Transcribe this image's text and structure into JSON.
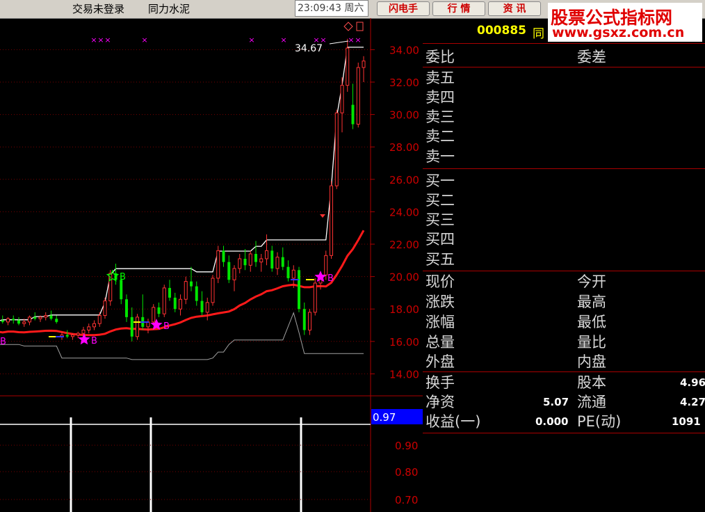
{
  "toolbar": {
    "login_status": "交易未登录",
    "stock_name": "同力水泥",
    "clock": "23:09:43 周六",
    "buttons": [
      "闪电手",
      "行 情",
      "资 讯"
    ]
  },
  "watermark": {
    "line1": "股票公式指标网",
    "line2": "www.gsxz.com.cn"
  },
  "colors": {
    "up": "#ff3232",
    "down": "#00e600",
    "grid": "#7a0000",
    "axis_text": "#cc0000",
    "ma_red": "#ff1a1a",
    "band_white": "#ffffff",
    "band_gray": "#a0a0a0",
    "signal_magenta": "#ff00ff",
    "signal_green": "#00ff00",
    "current_value_bg": "#0000ff"
  },
  "chart_data": {
    "type": "candlestick",
    "price_axis": {
      "ticks": [
        "34.00",
        "32.00",
        "30.00",
        "28.00",
        "26.00",
        "24.00",
        "22.00",
        "20.00",
        "18.00",
        "16.00",
        "14.00"
      ],
      "range": [
        13.2,
        35.6
      ]
    },
    "max_label": "34.67",
    "candles": [
      [
        17.2,
        17.5,
        17.0,
        17.3
      ],
      [
        17.3,
        17.6,
        17.1,
        17.2
      ],
      [
        17.2,
        17.5,
        17.0,
        17.4
      ],
      [
        17.4,
        17.6,
        17.1,
        17.3
      ],
      [
        17.3,
        17.5,
        17.0,
        17.1
      ],
      [
        17.1,
        17.4,
        16.9,
        17.2
      ],
      [
        17.2,
        17.6,
        17.0,
        17.5
      ],
      [
        17.5,
        17.8,
        17.3,
        17.4
      ],
      [
        17.4,
        17.6,
        17.2,
        17.5
      ],
      [
        17.5,
        17.8,
        17.3,
        17.6
      ],
      [
        17.6,
        17.9,
        17.3,
        17.4
      ],
      [
        17.4,
        17.6,
        17.1,
        17.2
      ],
      [
        16.3,
        16.6,
        16.1,
        16.4
      ],
      [
        16.4,
        16.7,
        16.2,
        16.3
      ],
      [
        16.3,
        16.5,
        16.1,
        16.4
      ],
      [
        16.4,
        16.6,
        16.2,
        16.5
      ],
      [
        16.5,
        16.9,
        16.4,
        16.7
      ],
      [
        16.7,
        17.1,
        16.5,
        16.9
      ],
      [
        16.9,
        17.3,
        16.7,
        17.1
      ],
      [
        17.1,
        17.8,
        16.9,
        17.6
      ],
      [
        17.6,
        18.7,
        17.4,
        18.5
      ],
      [
        18.5,
        20.4,
        18.2,
        20.2
      ],
      [
        20.2,
        20.8,
        19.5,
        19.8
      ],
      [
        19.8,
        20.1,
        18.3,
        18.6
      ],
      [
        18.6,
        18.9,
        17.2,
        17.5
      ],
      [
        17.5,
        18.1,
        16.0,
        16.3
      ],
      [
        16.3,
        17.7,
        16.1,
        17.5
      ],
      [
        17.5,
        18.9,
        16.7,
        16.9
      ],
      [
        16.9,
        17.4,
        16.5,
        17.2
      ],
      [
        17.2,
        18.3,
        17.0,
        18.1
      ],
      [
        18.1,
        18.4,
        17.5,
        17.7
      ],
      [
        17.7,
        19.5,
        17.5,
        19.3
      ],
      [
        19.3,
        19.8,
        18.5,
        18.7
      ],
      [
        18.7,
        19.0,
        17.8,
        18.0
      ],
      [
        18.0,
        18.9,
        17.6,
        18.6
      ],
      [
        18.6,
        20.0,
        18.3,
        19.7
      ],
      [
        19.7,
        20.6,
        19.1,
        19.4
      ],
      [
        19.4,
        19.7,
        18.2,
        18.5
      ],
      [
        18.5,
        19.1,
        17.6,
        17.8
      ],
      [
        17.8,
        18.7,
        17.3,
        18.4
      ],
      [
        18.4,
        20.1,
        18.2,
        19.9
      ],
      [
        19.9,
        21.9,
        19.6,
        21.6
      ],
      [
        21.6,
        21.9,
        20.6,
        20.9
      ],
      [
        20.9,
        21.3,
        19.6,
        19.8
      ],
      [
        19.8,
        20.7,
        19.1,
        20.5
      ],
      [
        20.5,
        21.4,
        20.2,
        21.1
      ],
      [
        21.1,
        21.7,
        20.4,
        20.7
      ],
      [
        20.7,
        21.6,
        20.3,
        21.4
      ],
      [
        21.4,
        22.2,
        20.6,
        20.9
      ],
      [
        20.9,
        21.4,
        20.3,
        21.1
      ],
      [
        21.1,
        22.6,
        20.7,
        21.6
      ],
      [
        21.6,
        21.9,
        20.3,
        20.5
      ],
      [
        20.5,
        21.5,
        20.1,
        21.2
      ],
      [
        21.2,
        21.8,
        20.4,
        20.6
      ],
      [
        20.6,
        21.0,
        19.7,
        19.9
      ],
      [
        19.9,
        20.7,
        19.3,
        20.4
      ],
      [
        20.4,
        20.6,
        17.8,
        18.0
      ],
      [
        18.0,
        18.4,
        16.4,
        16.7
      ],
      [
        16.7,
        18.0,
        16.4,
        17.8
      ],
      [
        17.8,
        19.9,
        17.6,
        19.6
      ],
      [
        19.6,
        20.3,
        19.2,
        20.1
      ],
      [
        20.1,
        21.6,
        19.8,
        21.3
      ],
      [
        21.3,
        25.9,
        21.1,
        25.6
      ],
      [
        25.6,
        30.3,
        25.4,
        30.1
      ],
      [
        30.1,
        32.3,
        28.9,
        31.8
      ],
      [
        31.8,
        34.67,
        31.4,
        34.1
      ],
      [
        30.6,
        31.9,
        29.1,
        29.4
      ],
      [
        29.4,
        33.2,
        29.2,
        32.9
      ],
      [
        32.9,
        33.6,
        32.0,
        33.3
      ]
    ],
    "signals": [
      "B",
      "B",
      "B",
      "B",
      "B",
      "B"
    ],
    "indicator_axis": {
      "current_value": "0.97",
      "ticks": [
        "0.90",
        "0.80",
        "0.70"
      ]
    }
  },
  "quote_panel": {
    "code": "000885",
    "name_short": "同",
    "wei_bi": "委比",
    "wei_cha": "委差",
    "sell_levels": [
      "卖五",
      "卖四",
      "卖三",
      "卖二",
      "卖一"
    ],
    "buy_levels": [
      "买一",
      "买二",
      "买三",
      "买四",
      "买五"
    ],
    "stats_left": [
      "现价",
      "涨跌",
      "涨幅",
      "总量",
      "外盘"
    ],
    "stats_right": [
      "今开",
      "最高",
      "最低",
      "量比",
      "内盘"
    ],
    "turnover_label": "换手",
    "share_capital_label": "股本",
    "share_capital_value": "4.96",
    "net_assets_label": "净资",
    "net_assets_value": "5.07",
    "float_label": "流通",
    "float_value": "4.27",
    "eps_label": "收益(一)",
    "eps_value": "0.000",
    "pe_label": "PE(动)",
    "pe_value": "1091"
  }
}
